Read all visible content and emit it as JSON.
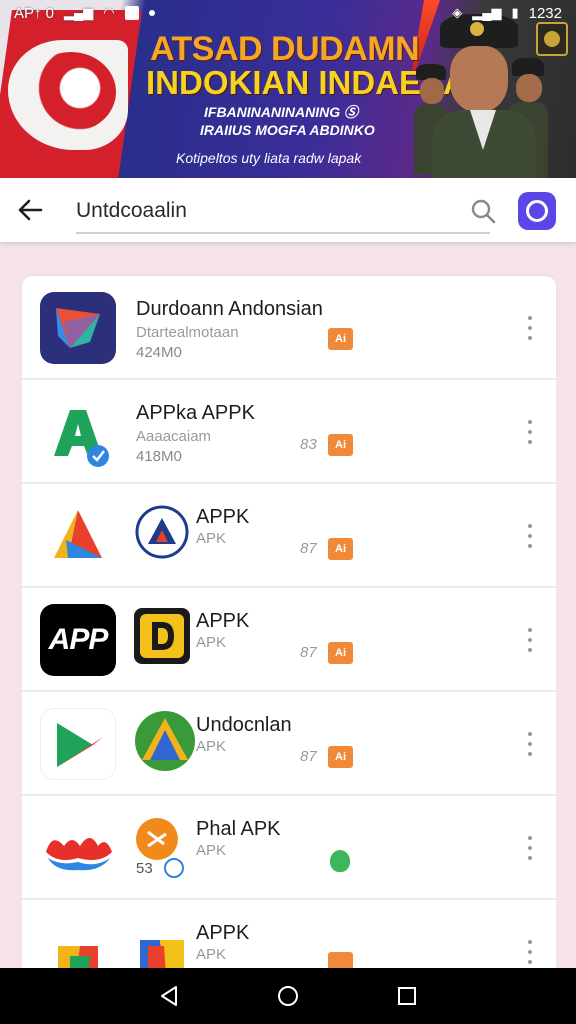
{
  "status_bar": {
    "left_text": "AP↑ 0",
    "time": "1232"
  },
  "banner": {
    "headline1": "ATSAD DUDAMN",
    "headline2": "INDOKIAN INDAESA",
    "sub1": "IFBANINANINANING Ⓢ",
    "sub2": "IRAIIUS MOGFA ABDINKO",
    "sub3": "Kotipeltos uty liata radw lapak"
  },
  "search": {
    "query": "Untdcoaalin"
  },
  "apps": [
    {
      "title": "Durdoann Andonsian",
      "subtitle": "Dtartealmotaan",
      "meta": "424M0",
      "badge_num": "",
      "badge": "orange",
      "badge_text": "Ai"
    },
    {
      "title": "APPka APPK",
      "subtitle": "Aaaacaiam",
      "meta": "418M0",
      "badge_num": "83",
      "badge": "orange",
      "badge_text": "Ai"
    },
    {
      "title": "APPK",
      "subtitle": "APK",
      "meta": "",
      "badge_num": "87",
      "badge": "orange",
      "badge_text": "Ai"
    },
    {
      "title": "APPK",
      "subtitle": "APK",
      "meta": "",
      "badge_num": "87",
      "badge": "orange",
      "badge_text": "Ai",
      "icon_text": "APP"
    },
    {
      "title": "Undocnlan",
      "subtitle": "APK",
      "meta": "",
      "badge_num": "87",
      "badge": "orange",
      "badge_text": "Ai"
    },
    {
      "title": "Phal APK",
      "subtitle": "APK",
      "meta": "53",
      "badge_num": "",
      "badge": "green",
      "badge_text": ""
    },
    {
      "title": "APPK",
      "subtitle": "APK",
      "meta": "",
      "badge_num": "",
      "badge": "orange",
      "badge_text": ""
    }
  ],
  "colors": {
    "accent": "#5b46e8",
    "badge_orange": "#f08a3a",
    "badge_green": "#3cb85a",
    "background": "#f6e3e8"
  },
  "icons": {
    "back": "arrow-left-icon",
    "search": "search-icon",
    "nav_back": "triangle-back-icon",
    "nav_home": "circle-home-icon",
    "nav_recents": "square-recents-icon"
  }
}
